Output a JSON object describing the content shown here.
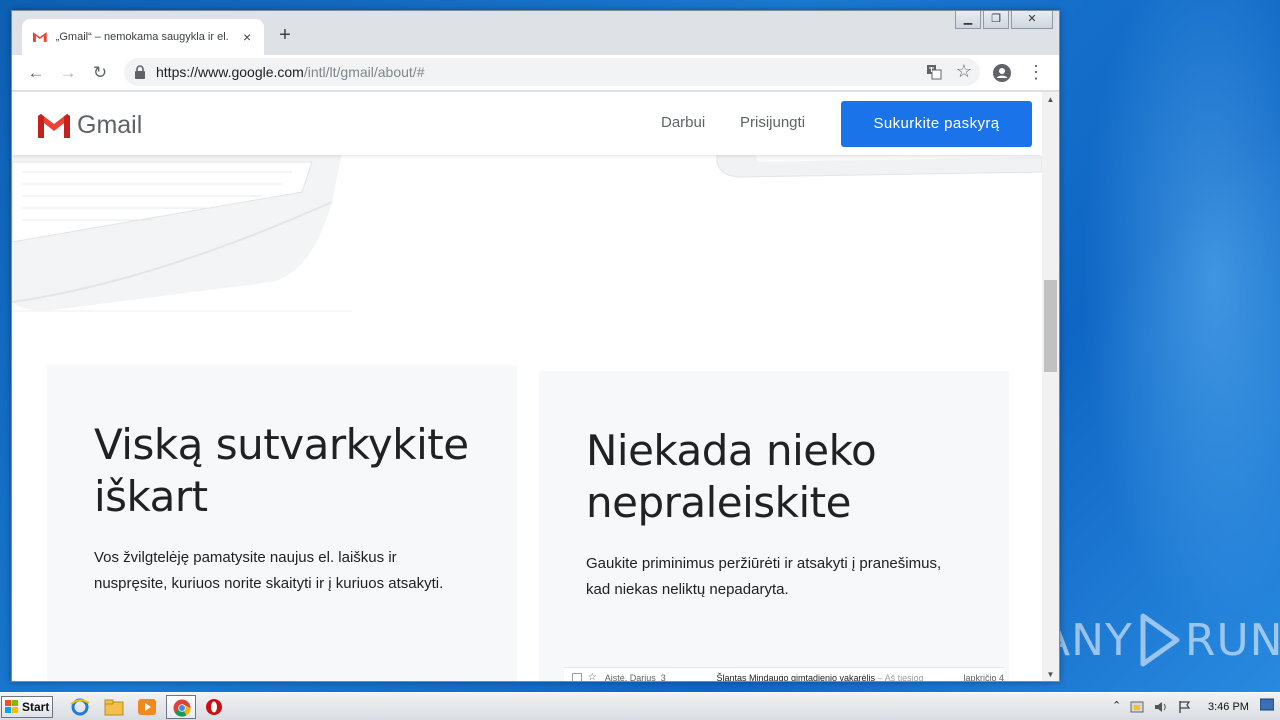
{
  "browser": {
    "tab_title": "„Gmail“ – nemokama saugykla ir el. p",
    "tab_close": "×",
    "new_tab": "+",
    "url_host": "https://www.google.com",
    "url_path": "/intl/lt/gmail/about/#",
    "star": "☆",
    "menu": "⋮",
    "back": "←",
    "forward": "→",
    "reload": "↻",
    "window_buttons": {
      "minimize": "▁",
      "restore": "❐",
      "close": "✕"
    }
  },
  "site": {
    "logo_text": "Gmail",
    "nav": {
      "work": "Darbui",
      "signin": "Prisijungti"
    },
    "cta": "Sukurkite paskyrą"
  },
  "cards": [
    {
      "title": "Viską sutvarkykite iškart",
      "body": "Vos žvilgtelėję pamatysite naujus el. laiškus ir nuspręsite, kuriuos norite skaityti ir į kuriuos atsakyti."
    },
    {
      "title": "Niekada nieko nepraleiskite",
      "body": "Gaukite priminimus peržiūrėti ir atsakyti į pranešimus, kad niekas neliktų nepadaryta."
    }
  ],
  "inbox_preview": {
    "sender": "Aistė, Darius",
    "count": "3",
    "subject": "Šlantas Mindaugo gimtadienio vakarėlis",
    "snippet": "– Aš tiesiog",
    "date": "lapkričio 4"
  },
  "taskbar": {
    "start_label": "Start",
    "clock": "3:46 PM",
    "tray_arrow": "⌃"
  },
  "watermark": {
    "left": "ANY",
    "right": "RUN"
  },
  "colors": {
    "cta": "#1a73e8",
    "gmail_red": "#ea4335"
  }
}
